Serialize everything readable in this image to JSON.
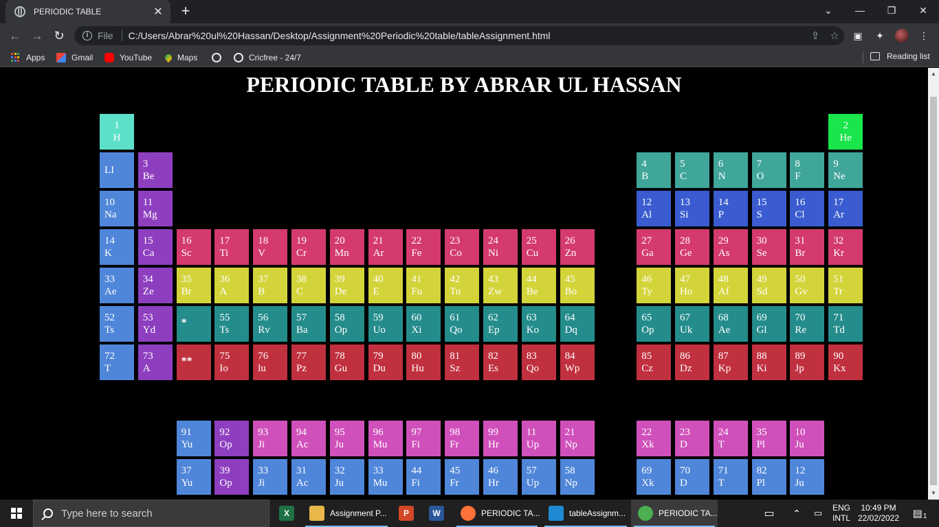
{
  "browser": {
    "tab_title": "PERIODIC TABLE",
    "new_tab": "+",
    "close_tab": "✕",
    "file_label": "File",
    "url": "C:/Users/Abrar%20ul%20Hassan/Desktop/Assignment%20Periodic%20table/tableAssignment.html",
    "bookmarks": [
      "Apps",
      "Gmail",
      "YouTube",
      "Maps",
      "",
      "Cricfree - 24/7"
    ],
    "reading_list": "Reading list"
  },
  "page": {
    "title": "PERIODIC TABLE BY ABRAR UL HASSAN"
  },
  "colors": {
    "cyan": "#5de0c8",
    "green": "#18e64a",
    "blue": "#4f86d9",
    "purple": "#8e3fc0",
    "teal": "#40a69a",
    "royal": "#3a5cd0",
    "pink": "#d43b6c",
    "yellow": "#d3d43a",
    "darkteal": "#258c8c",
    "crimson": "#c0303e",
    "magenta": "#d050bb"
  },
  "elements": [
    {
      "num": "1",
      "sym": "H",
      "row": 0,
      "col": 0,
      "color": "cyan",
      "center": true
    },
    {
      "num": "2",
      "sym": "He",
      "row": 0,
      "col": 19,
      "color": "green",
      "center": true
    },
    {
      "num": "",
      "sym": "LI",
      "row": 1,
      "col": 0,
      "color": "blue",
      "single": true
    },
    {
      "num": "3",
      "sym": "Be",
      "row": 1,
      "col": 1,
      "color": "purple"
    },
    {
      "num": "4",
      "sym": "B",
      "row": 1,
      "col": 14,
      "color": "teal"
    },
    {
      "num": "5",
      "sym": "C",
      "row": 1,
      "col": 15,
      "color": "teal"
    },
    {
      "num": "6",
      "sym": "N",
      "row": 1,
      "col": 16,
      "color": "teal"
    },
    {
      "num": "7",
      "sym": "O",
      "row": 1,
      "col": 17,
      "color": "teal"
    },
    {
      "num": "8",
      "sym": "F",
      "row": 1,
      "col": 18,
      "color": "teal"
    },
    {
      "num": "9",
      "sym": "Ne",
      "row": 1,
      "col": 19,
      "color": "teal"
    },
    {
      "num": "10",
      "sym": "Na",
      "row": 2,
      "col": 0,
      "color": "blue"
    },
    {
      "num": "11",
      "sym": "Mg",
      "row": 2,
      "col": 1,
      "color": "purple"
    },
    {
      "num": "12",
      "sym": "Al",
      "row": 2,
      "col": 14,
      "color": "royal"
    },
    {
      "num": "13",
      "sym": "Si",
      "row": 2,
      "col": 15,
      "color": "royal"
    },
    {
      "num": "14",
      "sym": "P",
      "row": 2,
      "col": 16,
      "color": "royal"
    },
    {
      "num": "15",
      "sym": "S",
      "row": 2,
      "col": 17,
      "color": "royal"
    },
    {
      "num": "16",
      "sym": "Cl",
      "row": 2,
      "col": 18,
      "color": "royal"
    },
    {
      "num": "17",
      "sym": "Ar",
      "row": 2,
      "col": 19,
      "color": "royal"
    },
    {
      "num": "14",
      "sym": "K",
      "row": 3,
      "col": 0,
      "color": "blue"
    },
    {
      "num": "15",
      "sym": "Ca",
      "row": 3,
      "col": 1,
      "color": "purple"
    },
    {
      "num": "16",
      "sym": "Sc",
      "row": 3,
      "col": 2,
      "color": "pink"
    },
    {
      "num": "17",
      "sym": "Ti",
      "row": 3,
      "col": 3,
      "color": "pink"
    },
    {
      "num": "18",
      "sym": "V",
      "row": 3,
      "col": 4,
      "color": "pink"
    },
    {
      "num": "19",
      "sym": "Cr",
      "row": 3,
      "col": 5,
      "color": "pink"
    },
    {
      "num": "20",
      "sym": "Mn",
      "row": 3,
      "col": 6,
      "color": "pink"
    },
    {
      "num": "21",
      "sym": "Ar",
      "row": 3,
      "col": 7,
      "color": "pink"
    },
    {
      "num": "22",
      "sym": "Fe",
      "row": 3,
      "col": 8,
      "color": "pink"
    },
    {
      "num": "23",
      "sym": "Co",
      "row": 3,
      "col": 9,
      "color": "pink"
    },
    {
      "num": "24",
      "sym": "Ni",
      "row": 3,
      "col": 10,
      "color": "pink"
    },
    {
      "num": "25",
      "sym": "Cu",
      "row": 3,
      "col": 11,
      "color": "pink"
    },
    {
      "num": "26",
      "sym": "Zn",
      "row": 3,
      "col": 12,
      "color": "pink"
    },
    {
      "num": "27",
      "sym": "Ga",
      "row": 3,
      "col": 14,
      "color": "pink"
    },
    {
      "num": "28",
      "sym": "Ge",
      "row": 3,
      "col": 15,
      "color": "pink"
    },
    {
      "num": "29",
      "sym": "As",
      "row": 3,
      "col": 16,
      "color": "pink"
    },
    {
      "num": "30",
      "sym": "Se",
      "row": 3,
      "col": 17,
      "color": "pink"
    },
    {
      "num": "31",
      "sym": "Br",
      "row": 3,
      "col": 18,
      "color": "pink"
    },
    {
      "num": "32",
      "sym": "Kr",
      "row": 3,
      "col": 19,
      "color": "pink"
    },
    {
      "num": "33",
      "sym": "Ae",
      "row": 4,
      "col": 0,
      "color": "blue"
    },
    {
      "num": "34",
      "sym": "Ze",
      "row": 4,
      "col": 1,
      "color": "purple"
    },
    {
      "num": "35",
      "sym": "Br",
      "row": 4,
      "col": 2,
      "color": "yellow"
    },
    {
      "num": "36",
      "sym": "A",
      "row": 4,
      "col": 3,
      "color": "yellow"
    },
    {
      "num": "37",
      "sym": "B",
      "row": 4,
      "col": 4,
      "color": "yellow"
    },
    {
      "num": "38",
      "sym": "C",
      "row": 4,
      "col": 5,
      "color": "yellow"
    },
    {
      "num": "39",
      "sym": "De",
      "row": 4,
      "col": 6,
      "color": "yellow"
    },
    {
      "num": "40",
      "sym": "E",
      "row": 4,
      "col": 7,
      "color": "yellow"
    },
    {
      "num": "41",
      "sym": "Fu",
      "row": 4,
      "col": 8,
      "color": "yellow"
    },
    {
      "num": "42",
      "sym": "Tu",
      "row": 4,
      "col": 9,
      "color": "yellow"
    },
    {
      "num": "43",
      "sym": "Zw",
      "row": 4,
      "col": 10,
      "color": "yellow"
    },
    {
      "num": "44",
      "sym": "Be",
      "row": 4,
      "col": 11,
      "color": "yellow"
    },
    {
      "num": "45",
      "sym": "Bo",
      "row": 4,
      "col": 12,
      "color": "yellow"
    },
    {
      "num": "46",
      "sym": "Ty",
      "row": 4,
      "col": 14,
      "color": "yellow"
    },
    {
      "num": "47",
      "sym": "Ho",
      "row": 4,
      "col": 15,
      "color": "yellow"
    },
    {
      "num": "48",
      "sym": "Af",
      "row": 4,
      "col": 16,
      "color": "yellow"
    },
    {
      "num": "49",
      "sym": "Sd",
      "row": 4,
      "col": 17,
      "color": "yellow"
    },
    {
      "num": "50",
      "sym": "Gv",
      "row": 4,
      "col": 18,
      "color": "yellow"
    },
    {
      "num": "51",
      "sym": "Tr",
      "row": 4,
      "col": 19,
      "color": "yellow"
    },
    {
      "num": "52",
      "sym": "Ts",
      "row": 5,
      "col": 0,
      "color": "blue"
    },
    {
      "num": "53",
      "sym": "Yd",
      "row": 5,
      "col": 1,
      "color": "purple"
    },
    {
      "num": "",
      "sym": "*",
      "row": 5,
      "col": 2,
      "color": "darkteal",
      "star": true
    },
    {
      "num": "55",
      "sym": "Ts",
      "row": 5,
      "col": 3,
      "color": "darkteal"
    },
    {
      "num": "56",
      "sym": "Rv",
      "row": 5,
      "col": 4,
      "color": "darkteal"
    },
    {
      "num": "57",
      "sym": "Ba",
      "row": 5,
      "col": 5,
      "color": "darkteal"
    },
    {
      "num": "58",
      "sym": "Op",
      "row": 5,
      "col": 6,
      "color": "darkteal"
    },
    {
      "num": "59",
      "sym": "Uo",
      "row": 5,
      "col": 7,
      "color": "darkteal"
    },
    {
      "num": "60",
      "sym": "Xi",
      "row": 5,
      "col": 8,
      "color": "darkteal"
    },
    {
      "num": "61",
      "sym": "Qo",
      "row": 5,
      "col": 9,
      "color": "darkteal"
    },
    {
      "num": "62",
      "sym": "Ep",
      "row": 5,
      "col": 10,
      "color": "darkteal"
    },
    {
      "num": "63",
      "sym": "Ko",
      "row": 5,
      "col": 11,
      "color": "darkteal"
    },
    {
      "num": "64",
      "sym": "Dq",
      "row": 5,
      "col": 12,
      "color": "darkteal"
    },
    {
      "num": "65",
      "sym": "Op",
      "row": 5,
      "col": 14,
      "color": "darkteal"
    },
    {
      "num": "67",
      "sym": "Uk",
      "row": 5,
      "col": 15,
      "color": "darkteal"
    },
    {
      "num": "68",
      "sym": "Ae",
      "row": 5,
      "col": 16,
      "color": "darkteal"
    },
    {
      "num": "69",
      "sym": "Gl",
      "row": 5,
      "col": 17,
      "color": "darkteal"
    },
    {
      "num": "70",
      "sym": "Re",
      "row": 5,
      "col": 18,
      "color": "darkteal"
    },
    {
      "num": "71",
      "sym": "Td",
      "row": 5,
      "col": 19,
      "color": "darkteal"
    },
    {
      "num": "72",
      "sym": "T",
      "row": 6,
      "col": 0,
      "color": "blue"
    },
    {
      "num": "73",
      "sym": "A",
      "row": 6,
      "col": 1,
      "color": "purple"
    },
    {
      "num": "",
      "sym": "**",
      "row": 6,
      "col": 2,
      "color": "crimson",
      "star": true
    },
    {
      "num": "75",
      "sym": "Io",
      "row": 6,
      "col": 3,
      "color": "crimson"
    },
    {
      "num": "76",
      "sym": "lu",
      "row": 6,
      "col": 4,
      "color": "crimson"
    },
    {
      "num": "77",
      "sym": "Pz",
      "row": 6,
      "col": 5,
      "color": "crimson"
    },
    {
      "num": "78",
      "sym": "Gu",
      "row": 6,
      "col": 6,
      "color": "crimson"
    },
    {
      "num": "79",
      "sym": "Du",
      "row": 6,
      "col": 7,
      "color": "crimson"
    },
    {
      "num": "80",
      "sym": "Hu",
      "row": 6,
      "col": 8,
      "color": "crimson"
    },
    {
      "num": "81",
      "sym": "Sz",
      "row": 6,
      "col": 9,
      "color": "crimson"
    },
    {
      "num": "82",
      "sym": "Es",
      "row": 6,
      "col": 10,
      "color": "crimson"
    },
    {
      "num": "83",
      "sym": "Qo",
      "row": 6,
      "col": 11,
      "color": "crimson"
    },
    {
      "num": "84",
      "sym": "Wp",
      "row": 6,
      "col": 12,
      "color": "crimson"
    },
    {
      "num": "85",
      "sym": "Cz",
      "row": 6,
      "col": 14,
      "color": "crimson"
    },
    {
      "num": "86",
      "sym": "Dz",
      "row": 6,
      "col": 15,
      "color": "crimson"
    },
    {
      "num": "87",
      "sym": "Kp",
      "row": 6,
      "col": 16,
      "color": "crimson"
    },
    {
      "num": "88",
      "sym": "Ki",
      "row": 6,
      "col": 17,
      "color": "crimson"
    },
    {
      "num": "89",
      "sym": "Jp",
      "row": 6,
      "col": 18,
      "color": "crimson"
    },
    {
      "num": "90",
      "sym": "Kx",
      "row": 6,
      "col": 19,
      "color": "crimson"
    },
    {
      "num": "91",
      "sym": "Yu",
      "row": 7,
      "col": 2,
      "color": "blue"
    },
    {
      "num": "92",
      "sym": "Op",
      "row": 7,
      "col": 3,
      "color": "purple"
    },
    {
      "num": "93",
      "sym": "Ji",
      "row": 7,
      "col": 4,
      "color": "magenta"
    },
    {
      "num": "94",
      "sym": "Ac",
      "row": 7,
      "col": 5,
      "color": "magenta"
    },
    {
      "num": "95",
      "sym": "Ju",
      "row": 7,
      "col": 6,
      "color": "magenta"
    },
    {
      "num": "96",
      "sym": "Mu",
      "row": 7,
      "col": 7,
      "color": "magenta"
    },
    {
      "num": "97",
      "sym": "Fi",
      "row": 7,
      "col": 8,
      "color": "magenta"
    },
    {
      "num": "98",
      "sym": "Fr",
      "row": 7,
      "col": 9,
      "color": "magenta"
    },
    {
      "num": "99",
      "sym": "Hr",
      "row": 7,
      "col": 10,
      "color": "magenta"
    },
    {
      "num": "11",
      "sym": "Up",
      "row": 7,
      "col": 11,
      "color": "magenta"
    },
    {
      "num": "21",
      "sym": "Np",
      "row": 7,
      "col": 12,
      "color": "magenta"
    },
    {
      "num": "22",
      "sym": "Xk",
      "row": 7,
      "col": 14,
      "color": "magenta"
    },
    {
      "num": "23",
      "sym": "D",
      "row": 7,
      "col": 15,
      "color": "magenta"
    },
    {
      "num": "24",
      "sym": "T",
      "row": 7,
      "col": 16,
      "color": "magenta"
    },
    {
      "num": "35",
      "sym": "Pl",
      "row": 7,
      "col": 17,
      "color": "magenta"
    },
    {
      "num": "10",
      "sym": "Ju",
      "row": 7,
      "col": 18,
      "color": "magenta"
    },
    {
      "num": "37",
      "sym": "Yu",
      "row": 8,
      "col": 2,
      "color": "blue"
    },
    {
      "num": "39",
      "sym": "Op",
      "row": 8,
      "col": 3,
      "color": "purple"
    },
    {
      "num": "33",
      "sym": "Ji",
      "row": 8,
      "col": 4,
      "color": "blue"
    },
    {
      "num": "31",
      "sym": "Ac",
      "row": 8,
      "col": 5,
      "color": "blue"
    },
    {
      "num": "32",
      "sym": "Ju",
      "row": 8,
      "col": 6,
      "color": "blue"
    },
    {
      "num": "33",
      "sym": "Mu",
      "row": 8,
      "col": 7,
      "color": "blue"
    },
    {
      "num": "44",
      "sym": "Fi",
      "row": 8,
      "col": 8,
      "color": "blue"
    },
    {
      "num": "45",
      "sym": "Fr",
      "row": 8,
      "col": 9,
      "color": "blue"
    },
    {
      "num": "46",
      "sym": "Hr",
      "row": 8,
      "col": 10,
      "color": "blue"
    },
    {
      "num": "57",
      "sym": "Up",
      "row": 8,
      "col": 11,
      "color": "blue"
    },
    {
      "num": "58",
      "sym": "Np",
      "row": 8,
      "col": 12,
      "color": "blue"
    },
    {
      "num": "69",
      "sym": "Xk",
      "row": 8,
      "col": 14,
      "color": "blue"
    },
    {
      "num": "70",
      "sym": "D",
      "row": 8,
      "col": 15,
      "color": "blue"
    },
    {
      "num": "71",
      "sym": "T",
      "row": 8,
      "col": 16,
      "color": "blue"
    },
    {
      "num": "82",
      "sym": "Pl",
      "row": 8,
      "col": 17,
      "color": "blue"
    },
    {
      "num": "12",
      "sym": "Ju",
      "row": 8,
      "col": 18,
      "color": "blue"
    }
  ],
  "taskbar": {
    "search_placeholder": "Type here to search",
    "apps": [
      {
        "label": "",
        "icon": "excel-icon",
        "badge": "X",
        "color": "#1e7145"
      },
      {
        "label": "Assignment P...",
        "icon": "folder-icon",
        "badge": "",
        "color": "#e8b84a"
      },
      {
        "label": "",
        "icon": "powerpoint-icon",
        "badge": "P",
        "color": "#d24726"
      },
      {
        "label": "",
        "icon": "word-icon",
        "badge": "W",
        "color": "#2b579a"
      },
      {
        "label": "PERIODIC TA...",
        "icon": "firefox-icon",
        "badge": "",
        "color": "#ff7139"
      },
      {
        "label": "tableAssignm...",
        "icon": "vscode-icon",
        "badge": "",
        "color": "#1f8ad2"
      },
      {
        "label": "PERIODIC TA...",
        "icon": "chrome-icon",
        "badge": "",
        "color": "#4caf50"
      }
    ],
    "lang1": "ENG",
    "lang2": "INTL",
    "time": "10:49 PM",
    "date": "22/02/2022",
    "notifications": "1"
  }
}
